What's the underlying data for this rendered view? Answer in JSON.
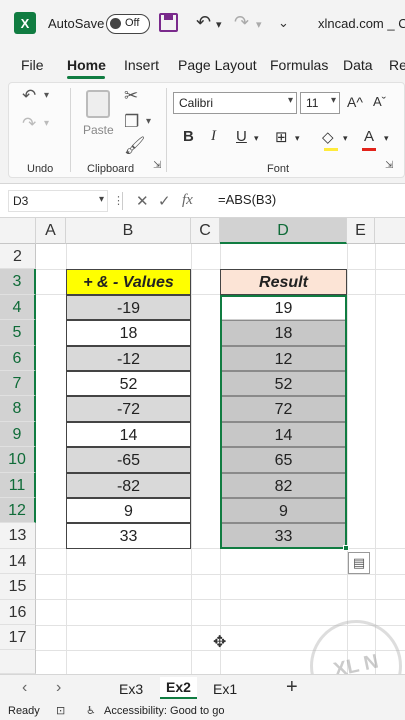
{
  "titlebar": {
    "autosave_label": "AutoSave",
    "toggle_state": "Off",
    "filename": "xlncad.com _ C"
  },
  "tabs": [
    "File",
    "Home",
    "Insert",
    "Page Layout",
    "Formulas",
    "Data",
    "Rev"
  ],
  "active_tab": "Home",
  "ribbon": {
    "undo_label": "Undo",
    "paste_label": "Paste",
    "clipboard_label": "Clipboard",
    "font_name": "Calibri",
    "font_size": "11",
    "font_group_label": "Font",
    "bold": "B",
    "italic": "I",
    "underline": "U",
    "font_color_letter": "A"
  },
  "formula_bar": {
    "name_box": "D3",
    "formula": "=ABS(B3)"
  },
  "columns": [
    "A",
    "B",
    "C",
    "D",
    "E"
  ],
  "rows": [
    "2",
    "3",
    "4",
    "5",
    "6",
    "7",
    "8",
    "9",
    "10",
    "11",
    "12",
    "13",
    "14",
    "15",
    "16",
    "17"
  ],
  "table": {
    "header_b": "+ & - Values",
    "header_d": "Result",
    "values": [
      "-19",
      "18",
      "-12",
      "52",
      "-72",
      "14",
      "-65",
      "-82",
      "9",
      "33"
    ],
    "results": [
      "19",
      "18",
      "12",
      "52",
      "72",
      "14",
      "65",
      "82",
      "9",
      "33"
    ]
  },
  "sheets": [
    "Ex3",
    "Ex2",
    "Ex1"
  ],
  "active_sheet": "Ex2",
  "status": {
    "ready": "Ready",
    "accessibility": "Accessibility: Good to go"
  },
  "watermark": "XL N CAD",
  "colors": {
    "excel_green": "#107c41",
    "header_yellow": "#ffff00",
    "header_peach": "#fce4d6",
    "cell_gray": "#d9d9d9"
  }
}
